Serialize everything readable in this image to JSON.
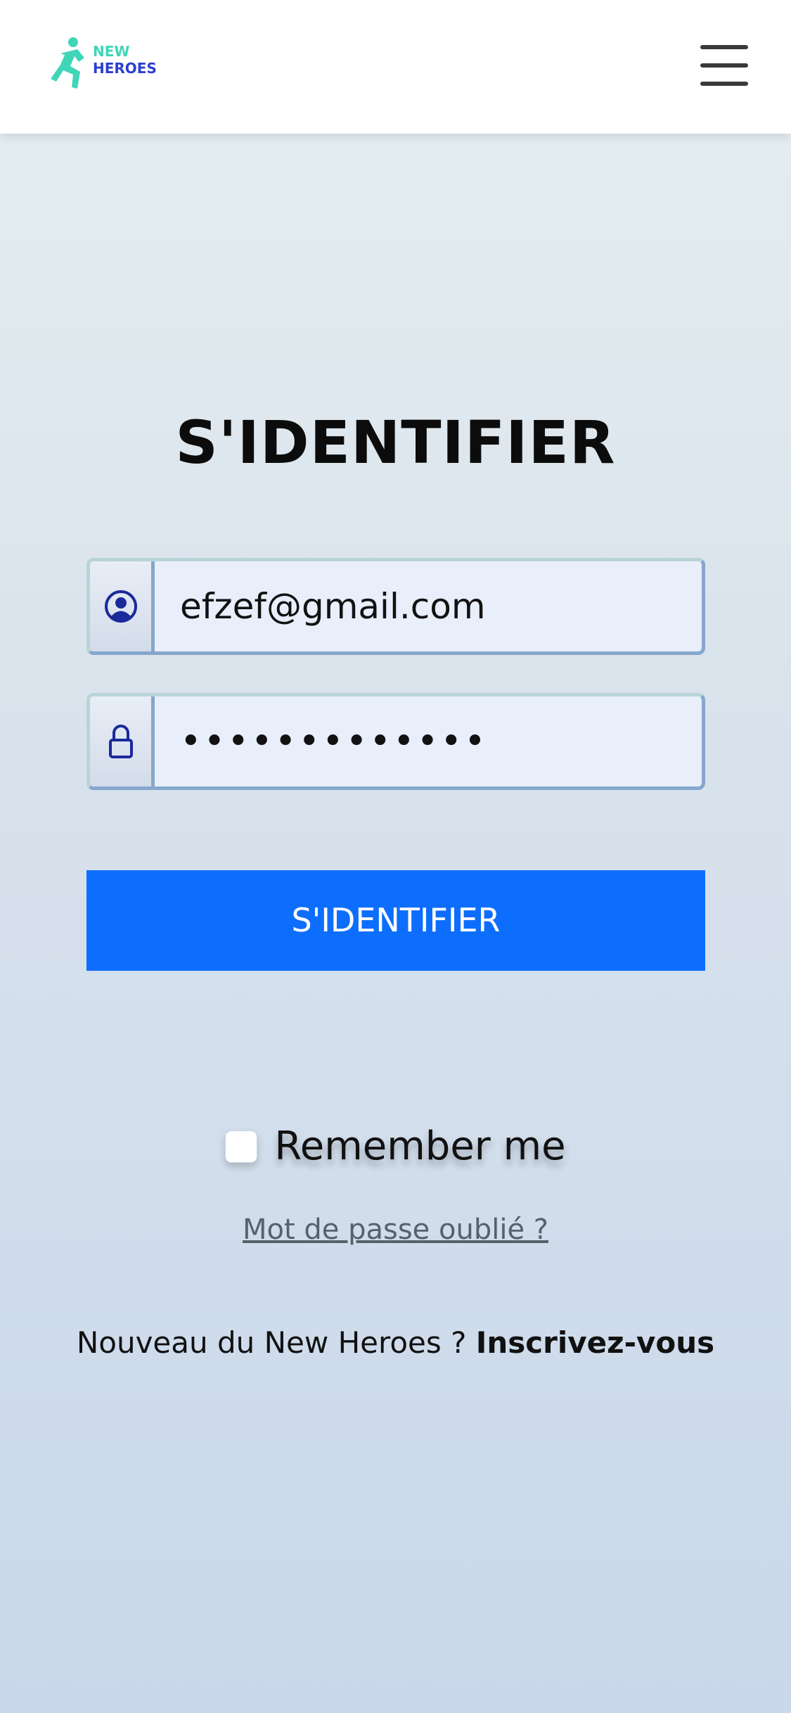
{
  "header": {
    "logo_text_line1": "NEW",
    "logo_text_line2": "HEROES",
    "menu_icon": "hamburger-menu-icon"
  },
  "login": {
    "title": "S'IDENTIFIER",
    "email": {
      "icon": "user-circle-icon",
      "value": "efzef@gmail.com"
    },
    "password": {
      "icon": "lock-icon",
      "value": "•••••••••••••"
    },
    "submit_label": "S'IDENTIFIER",
    "remember_label": "Remember me",
    "remember_checked": false,
    "forgot_label": "Mot de passe oublié ?",
    "signup_prompt": "Nouveau du New Heroes ? ",
    "signup_link": "Inscrivez-vous"
  },
  "colors": {
    "primary_button": "#0d6efd",
    "logo_blue": "#1c2bb0",
    "logo_teal": "#3fd6b8",
    "field_bg": "#e8effb",
    "field_border": "#86a7cc"
  }
}
